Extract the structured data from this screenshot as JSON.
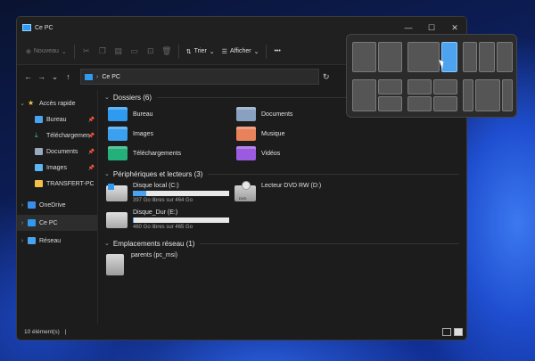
{
  "window": {
    "title": "Ce PC"
  },
  "toolbar": {
    "new_label": "Nouveau",
    "sort_label": "Trier",
    "view_label": "Afficher"
  },
  "address": {
    "path": "Ce PC"
  },
  "sidebar": {
    "items": [
      {
        "label": "Accès rapide",
        "icon": "star-icon",
        "color": "#f5c542",
        "pinned": false
      },
      {
        "label": "Bureau",
        "icon": "desktop-icon",
        "color": "#4aa3f0",
        "pinned": true
      },
      {
        "label": "Téléchargemen",
        "icon": "download-icon",
        "color": "#3cc47c",
        "pinned": true
      },
      {
        "label": "Documents",
        "icon": "document-icon",
        "color": "#9aa9bd",
        "pinned": true
      },
      {
        "label": "Images",
        "icon": "images-icon",
        "color": "#5db7f5",
        "pinned": true
      },
      {
        "label": "TRANSFERT-PC",
        "icon": "folder-icon",
        "color": "#f3c14a",
        "pinned": false
      },
      {
        "label": "OneDrive",
        "icon": "cloud-icon",
        "color": "#3b8ee8",
        "pinned": false
      },
      {
        "label": "Ce PC",
        "icon": "computer-icon",
        "color": "#2f9bf0",
        "pinned": false
      },
      {
        "label": "Réseau",
        "icon": "network-icon",
        "color": "#4aa3f0",
        "pinned": false
      }
    ]
  },
  "sections": {
    "folders_title": "Dossiers (6)",
    "devices_title": "Périphériques et lecteurs (3)",
    "network_title": "Emplacements réseau (1)"
  },
  "folders": [
    {
      "label": "Bureau",
      "icon": "desktop-folder-icon",
      "color": "#2f9bf0"
    },
    {
      "label": "Documents",
      "icon": "documents-folder-icon",
      "color": "#8aa0c0"
    },
    {
      "label": "Images",
      "icon": "images-folder-icon",
      "color": "#3aa0f0"
    },
    {
      "label": "Musique",
      "icon": "music-folder-icon",
      "color": "#e8825a"
    },
    {
      "label": "Téléchargements",
      "icon": "downloads-folder-icon",
      "color": "#23b07a"
    },
    {
      "label": "Vidéos",
      "icon": "videos-folder-icon",
      "color": "#9b5be0"
    }
  ],
  "drives": [
    {
      "name": "Disque local (C:)",
      "free": "397 Go libres sur 464 Go",
      "used_fraction": 0.14,
      "icon": "windows-drive-icon"
    },
    {
      "name": "Lecteur DVD RW (D:)",
      "free": "",
      "used_fraction": null,
      "icon": "dvd-drive-icon",
      "dvd_label": "DVD"
    },
    {
      "name": "Disque_Dur (E:)",
      "free": "460 Go libres sur 465 Go",
      "used_fraction": 0.01,
      "icon": "hard-drive-icon"
    }
  ],
  "network": [
    {
      "name": "parents (pc_msi)",
      "icon": "network-share-icon"
    }
  ],
  "status": {
    "count": "10 élément(s)",
    "separator": "|"
  }
}
